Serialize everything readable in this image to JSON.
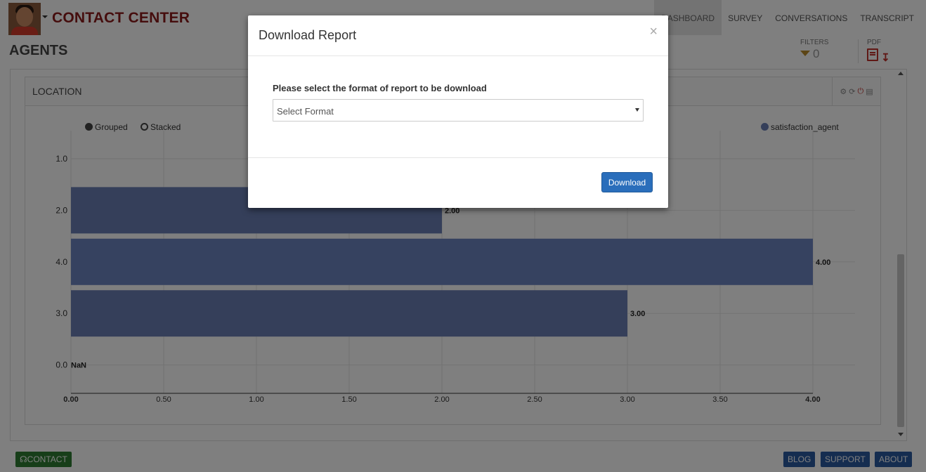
{
  "header": {
    "app_title": "CONTACT CENTER",
    "nav": [
      "DASHBOARD",
      "SURVEY",
      "CONVERSATIONS",
      "TRANSCRIPT"
    ],
    "active_nav": "DASHBOARD"
  },
  "page": {
    "title": "AGENTS",
    "filters_label": "FILTERS",
    "filters_count": "0",
    "pdf_label": "PDF"
  },
  "panel": {
    "title": "LOCATION",
    "legend": {
      "grouped": "Grouped",
      "stacked": "Stacked",
      "series": "satisfaction_agent"
    }
  },
  "chart_data": {
    "type": "bar",
    "orientation": "horizontal",
    "categories": [
      "1.0",
      "2.0",
      "4.0",
      "3.0",
      "0.0"
    ],
    "series": [
      {
        "name": "satisfaction_agent",
        "values": [
          null,
          2.0,
          4.0,
          3.0,
          null
        ],
        "labels": [
          "",
          "2.00",
          "4.00",
          "3.00",
          "NaN"
        ]
      }
    ],
    "xticks": [
      "0.00",
      "0.50",
      "1.00",
      "1.50",
      "2.00",
      "2.50",
      "3.00",
      "3.50",
      "4.00"
    ],
    "xlim": [
      0,
      4
    ],
    "grid": true,
    "legend_position": "top-right",
    "colors": {
      "bar": "#6a7fb5",
      "bar_highlight": "#6d84c0"
    }
  },
  "footer": {
    "contact": "CONTACT",
    "links": [
      "BLOG",
      "SUPPORT",
      "ABOUT"
    ]
  },
  "modal": {
    "title": "Download Report",
    "close": "×",
    "field_label": "Please select the format of report to be download",
    "select_value": "Select Format",
    "download_label": "Download"
  }
}
